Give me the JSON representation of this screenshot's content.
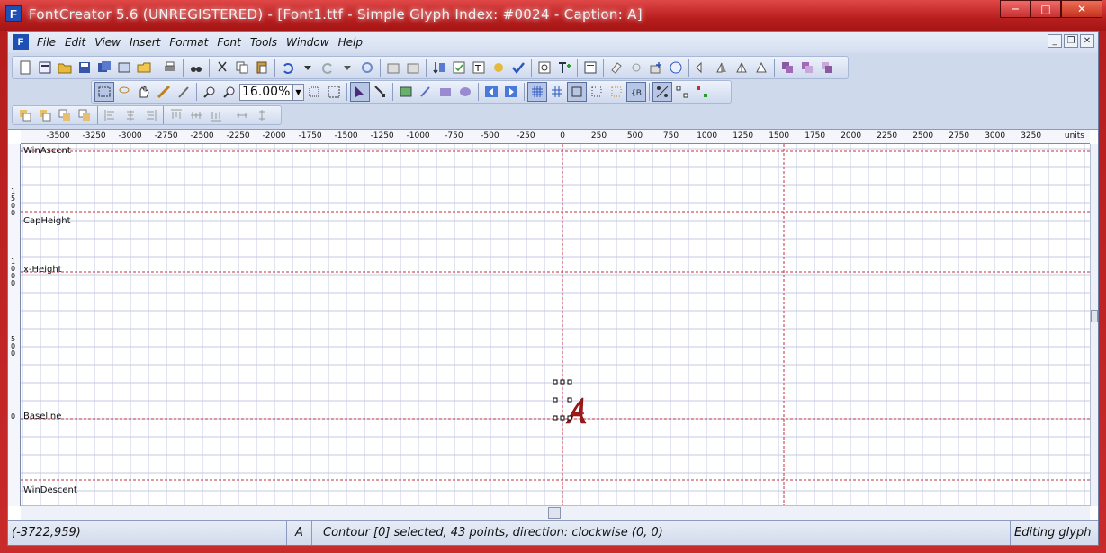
{
  "window": {
    "title": "FontCreator 5.6 (UNREGISTERED) - [Font1.ttf - Simple Glyph Index: #0024 - Caption: A]",
    "controls": {
      "minimize": "─",
      "maximize": "□",
      "close": "✕"
    }
  },
  "menubar": {
    "items": [
      "File",
      "Edit",
      "View",
      "Insert",
      "Format",
      "Font",
      "Tools",
      "Window",
      "Help"
    ],
    "mdi": {
      "minimize": "_",
      "restore": "❐",
      "close": "✕"
    }
  },
  "toolbar": {
    "zoom_value": "16.00%"
  },
  "ruler": {
    "units_label": "units",
    "ticks": [
      "-3500",
      "-3250",
      "-3000",
      "-2750",
      "-2500",
      "-2250",
      "-2000",
      "-1750",
      "-1500",
      "-1250",
      "-1000",
      "-750",
      "-500",
      "-250",
      "0",
      "250",
      "500",
      "750",
      "1000",
      "1250",
      "1500",
      "1750",
      "2000",
      "2250",
      "2500",
      "2750",
      "3000",
      "3250"
    ],
    "vertical_marks": [
      {
        "digits": [
          "1",
          "5",
          "0",
          "0"
        ]
      },
      {
        "digits": [
          "1",
          "0",
          "0",
          "0"
        ]
      },
      {
        "digits": [
          "5",
          "0",
          "0"
        ]
      },
      {
        "digits": [
          "0"
        ]
      }
    ]
  },
  "metrics": {
    "win_ascent": "WinAscent",
    "cap_height": "CapHeight",
    "x_height": "x-Height",
    "baseline": "Baseline",
    "win_descent": "WinDescent"
  },
  "glyph": {
    "character": "A",
    "color": "#a01818"
  },
  "statusbar": {
    "coords": "(-3722,959)",
    "glyph_char": "A",
    "message": "Contour [0] selected, 43 points, direction: clockwise (0, 0)",
    "mode": "Editing glyph"
  },
  "colors": {
    "grid": "#c6c8e6",
    "guide": "#c0303c",
    "titlebar": "#c02424"
  }
}
